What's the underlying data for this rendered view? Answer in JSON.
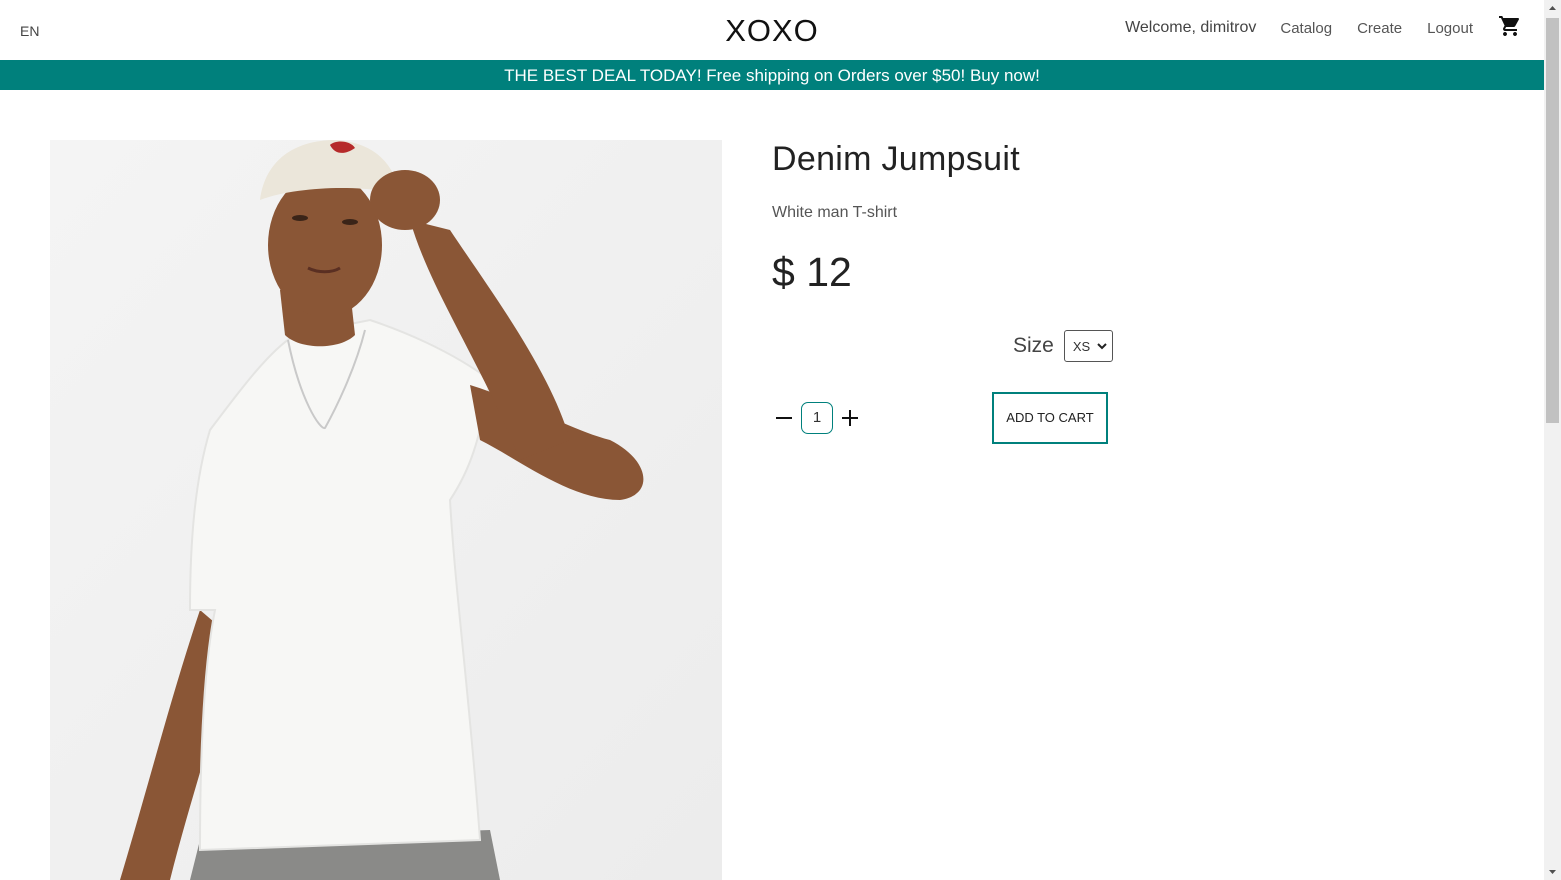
{
  "header": {
    "language": "EN",
    "logo": "XOXO",
    "welcome": "Welcome, dimitrov",
    "nav": [
      "Catalog",
      "Create",
      "Logout"
    ]
  },
  "banner": {
    "text": "THE BEST DEAL TODAY! Free shipping on Orders over $50! Buy now!",
    "color": "#00807c"
  },
  "product": {
    "title": "Denim Jumpsuit",
    "description": "White man T-shirt",
    "price": "$ 12",
    "size_label": "Size",
    "size_selected": "XS",
    "quantity": "1",
    "add_to_cart_label": "ADD TO CART"
  },
  "accent_color": "#00807c"
}
